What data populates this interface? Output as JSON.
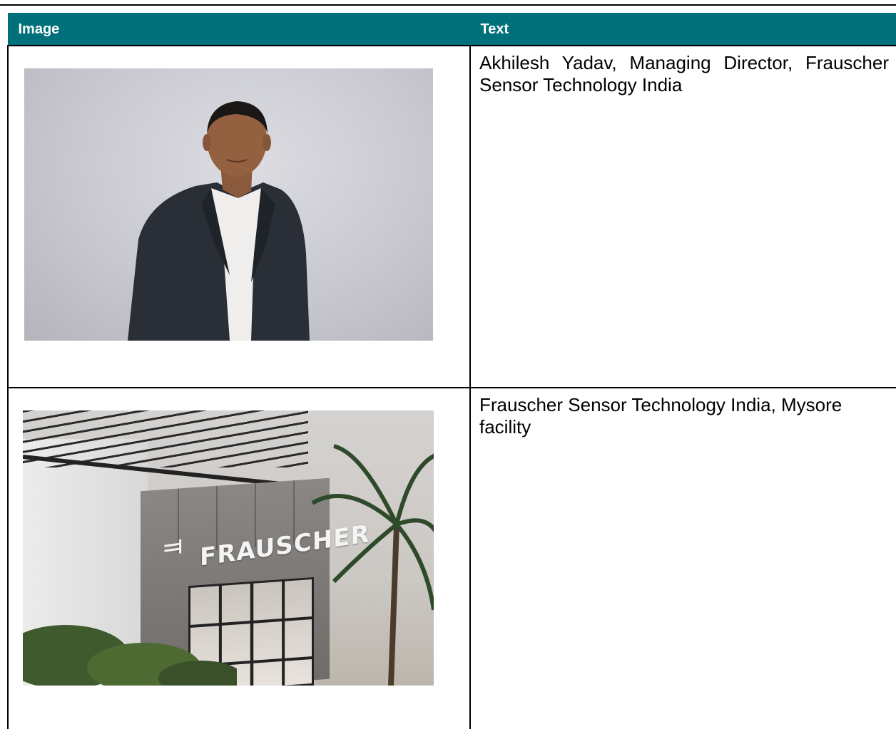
{
  "table": {
    "headers": [
      "Image",
      "Text"
    ],
    "rows": [
      {
        "image_alt": "Portrait of Akhilesh Yadav",
        "text": "Akhilesh Yadav, Managing Director, Frauscher Sensor Technology India"
      },
      {
        "image_alt": "Frauscher building in Mysore",
        "text": "Frauscher Sensor Technology India, Mysore facility",
        "sign_text": "FRAUSCHER"
      }
    ]
  },
  "colors": {
    "header_bg": "#00707a",
    "header_text": "#ffffff"
  }
}
